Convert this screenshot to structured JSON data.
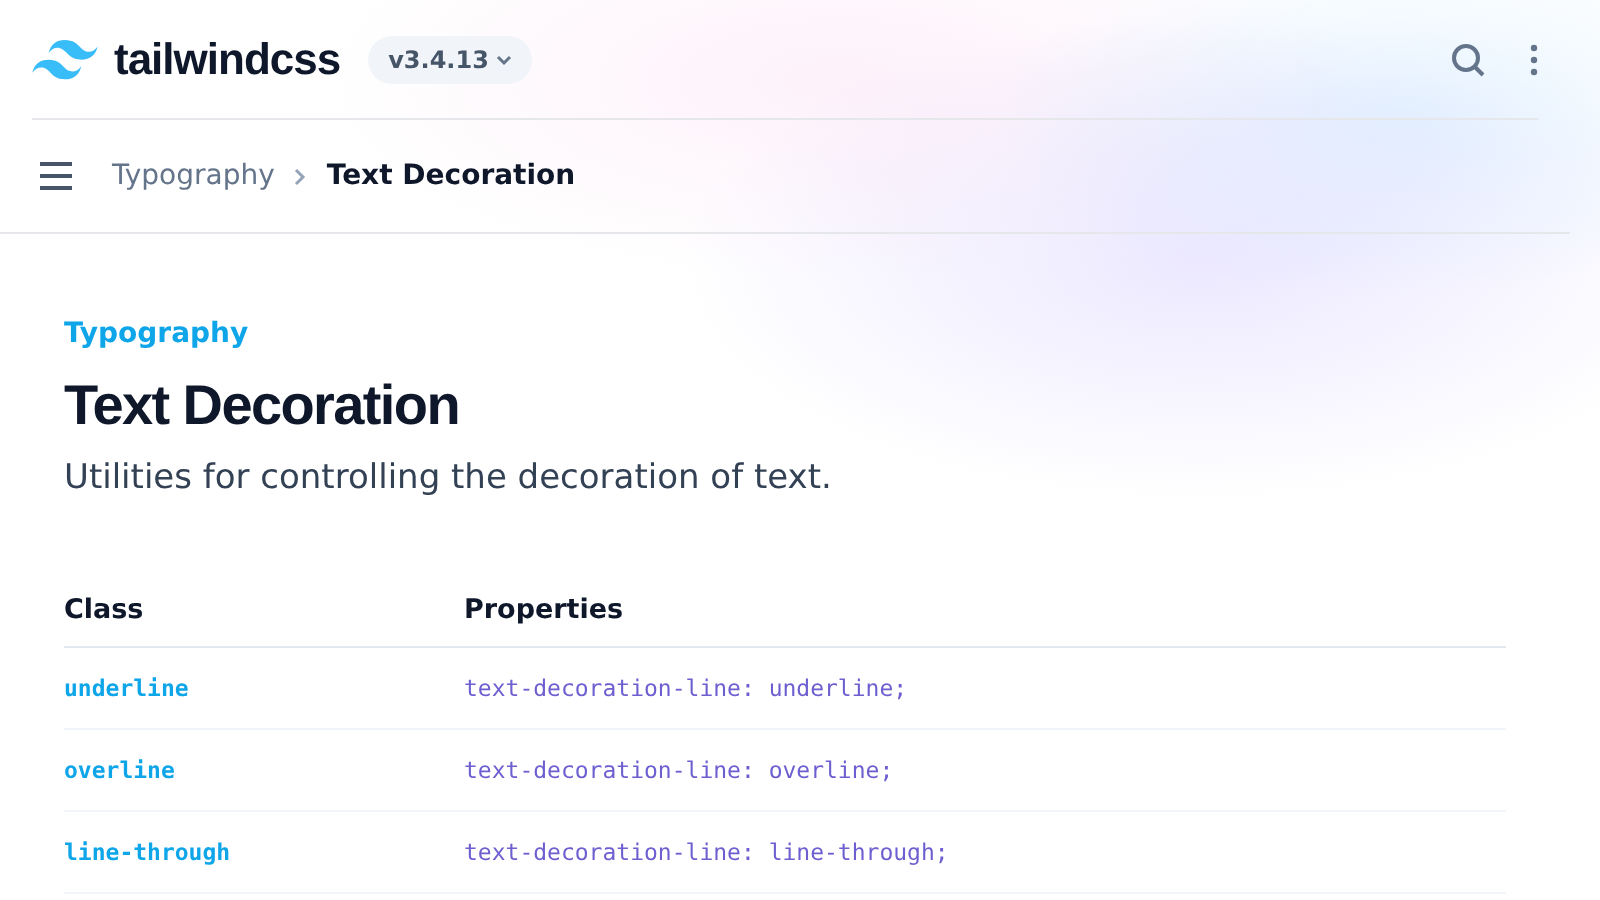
{
  "header": {
    "logo_text": "tailwindcss",
    "version": "v3.4.13"
  },
  "breadcrumb": {
    "items": [
      "Typography",
      "Text Decoration"
    ]
  },
  "page": {
    "eyebrow": "Typography",
    "title": "Text Decoration",
    "description": "Utilities for controlling the decoration of text."
  },
  "table": {
    "columns": [
      "Class",
      "Properties"
    ],
    "rows": [
      {
        "class": "underline",
        "properties": "text-decoration-line: underline;"
      },
      {
        "class": "overline",
        "properties": "text-decoration-line: overline;"
      },
      {
        "class": "line-through",
        "properties": "text-decoration-line: line-through;"
      }
    ]
  }
}
